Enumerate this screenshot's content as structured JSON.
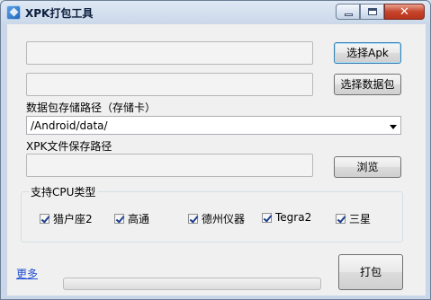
{
  "window": {
    "title": "XPK打包工具",
    "min_icon": "minimize-icon",
    "max_icon": "maximize-icon",
    "close_icon": "close-icon"
  },
  "apk": {
    "path_value": "",
    "button_label": "选择Apk"
  },
  "data_package": {
    "path_value": "",
    "button_label": "选择数据包"
  },
  "storage": {
    "label": "数据包存储路径（存储卡）",
    "selected": "/Android/data/"
  },
  "xpk_save": {
    "label": "XPK文件保存路径",
    "path_value": "",
    "button_label": "浏览"
  },
  "cpu_group": {
    "title": "支持CPU类型",
    "options": [
      {
        "label": "猎户座2",
        "checked": true
      },
      {
        "label": "高通",
        "checked": true
      },
      {
        "label": "德州仪器",
        "checked": true
      },
      {
        "label": "Tegra2",
        "checked": true
      },
      {
        "label": "三星",
        "checked": true
      }
    ]
  },
  "footer": {
    "more_link": "更多",
    "progress": 0,
    "pack_button": "打包"
  }
}
